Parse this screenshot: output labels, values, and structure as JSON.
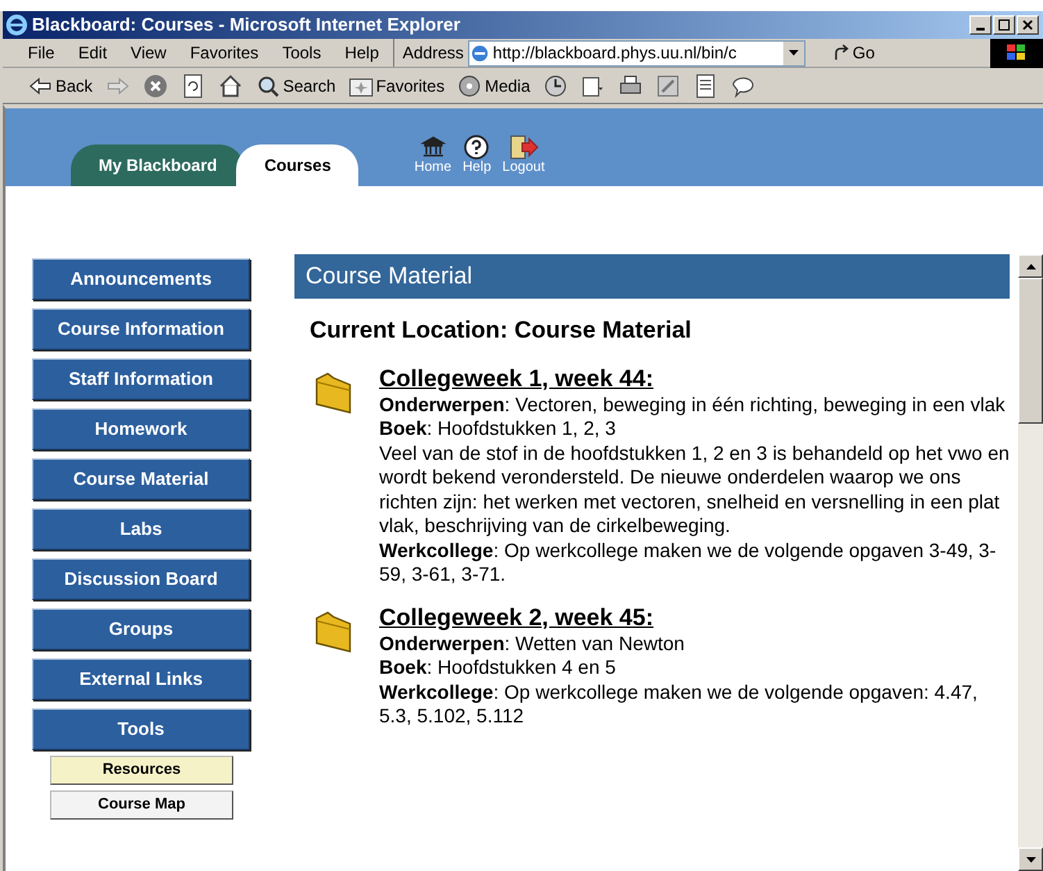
{
  "window": {
    "title": "Blackboard: Courses - Microsoft Internet Explorer"
  },
  "menu": [
    "File",
    "Edit",
    "View",
    "Favorites",
    "Tools",
    "Help"
  ],
  "address": {
    "label": "Address",
    "value": "http://blackboard.phys.uu.nl/bin/c",
    "go": "Go"
  },
  "toolbar": [
    {
      "kind": "back",
      "label": "Back"
    },
    {
      "kind": "forward"
    },
    {
      "kind": "stop"
    },
    {
      "kind": "refresh"
    },
    {
      "kind": "home"
    },
    {
      "kind": "search",
      "label": "Search"
    },
    {
      "kind": "favorites",
      "label": "Favorites"
    },
    {
      "kind": "media",
      "label": "Media"
    },
    {
      "kind": "history"
    },
    {
      "kind": "mail"
    },
    {
      "kind": "print"
    },
    {
      "kind": "edit"
    },
    {
      "kind": "discuss"
    },
    {
      "kind": "messenger"
    }
  ],
  "tabs": [
    {
      "label": "My Blackboard",
      "selected": false
    },
    {
      "label": "Courses",
      "selected": true
    }
  ],
  "header_links": [
    {
      "kind": "home",
      "label": "Home"
    },
    {
      "kind": "help",
      "label": "Help"
    },
    {
      "kind": "logout",
      "label": "Logout"
    }
  ],
  "sidebar": {
    "items": [
      {
        "label": "Announcements",
        "kind": "main"
      },
      {
        "label": "Course Information",
        "kind": "main"
      },
      {
        "label": "Staff Information",
        "kind": "main"
      },
      {
        "label": "Homework",
        "kind": "main"
      },
      {
        "label": "Course Material",
        "kind": "main"
      },
      {
        "label": "Labs",
        "kind": "main"
      },
      {
        "label": "Discussion Board",
        "kind": "main"
      },
      {
        "label": "Groups",
        "kind": "main"
      },
      {
        "label": "External Links",
        "kind": "main"
      },
      {
        "label": "Tools",
        "kind": "main"
      },
      {
        "label": "Resources",
        "kind": "tool",
        "color": "#f6f2c8"
      },
      {
        "label": "Course Map",
        "kind": "tool",
        "color": "#f4f3f4"
      }
    ]
  },
  "content": {
    "title": "Course Material",
    "location": "Current Location: Course Material",
    "items": [
      {
        "title": "Collegeweek 1, week 44:",
        "paragraphs": [
          "**Onderwerpen**: Vectoren, beweging in één richting, beweging in een vlak",
          "**Boek**: Hoofdstukken 1, 2, 3",
          "Veel van de stof in de hoofdstukken 1, 2 en 3 is behandeld op het vwo en wordt bekend verondersteld. De nieuwe onderdelen waarop we ons richten zijn: het werken met vectoren, snelheid en versnelling in een plat vlak, beschrijving van de cirkelbeweging.",
          "**Werkcollege**: Op werkcollege maken we de volgende opgaven 3-49, 3-59, 3-61, 3-71."
        ]
      },
      {
        "title": "Collegeweek 2, week 45:",
        "paragraphs": [
          "**Onderwerpen**: Wetten van Newton",
          "**Boek**: Hoofdstukken 4 en 5",
          "**Werkcollege**: Op werkcollege maken we de volgende opgaven: 4.47, 5.3, 5.102, 5.112"
        ]
      }
    ]
  }
}
